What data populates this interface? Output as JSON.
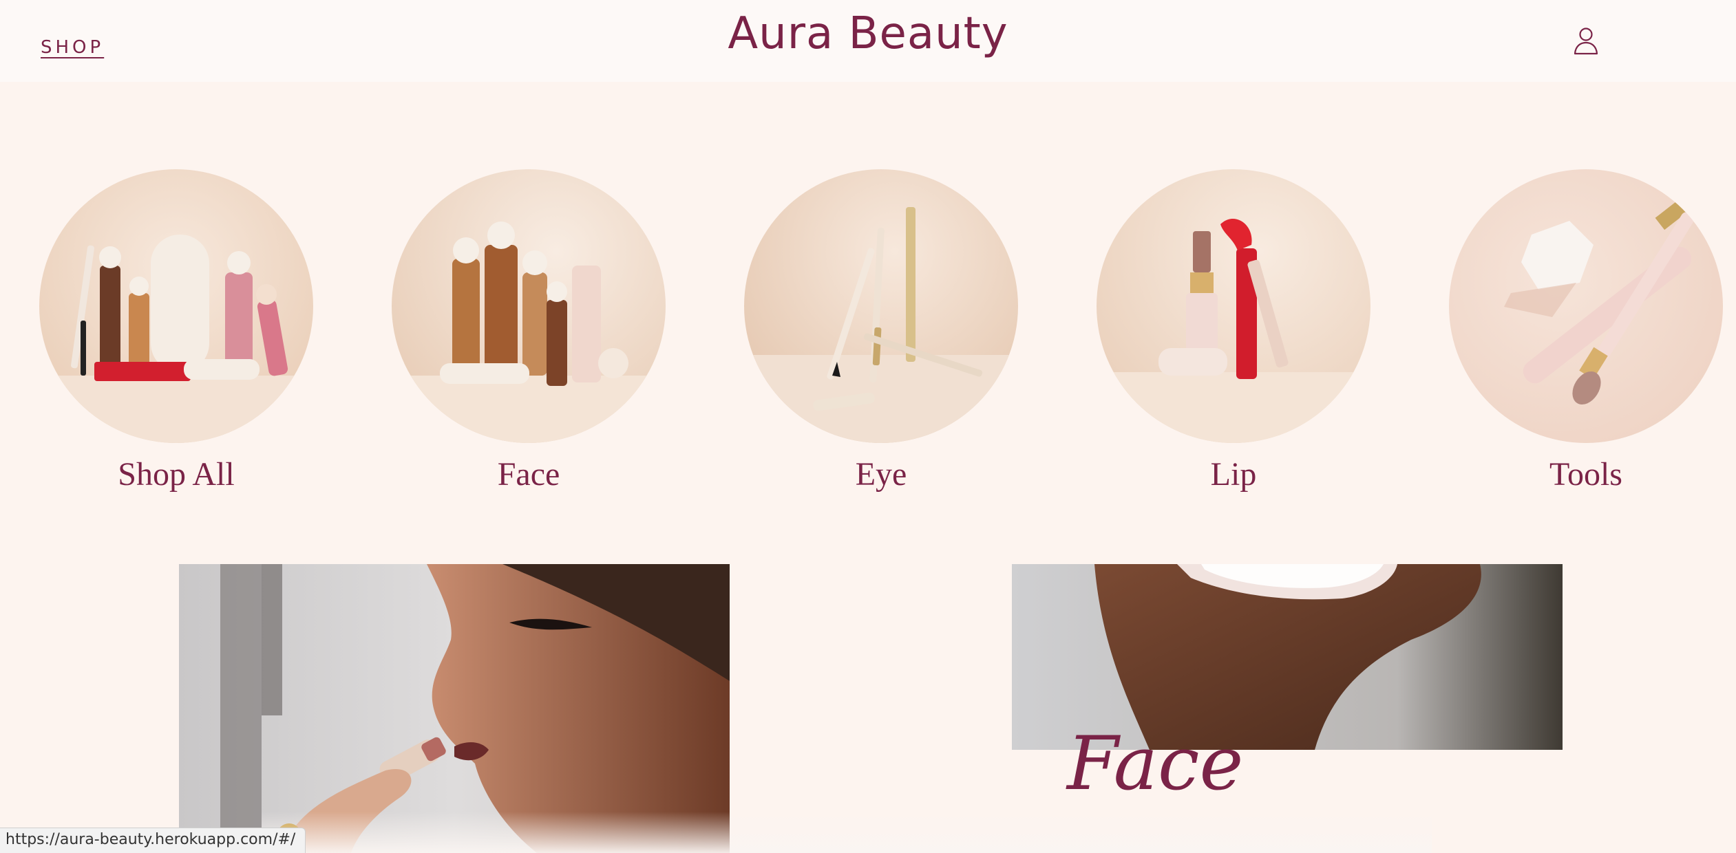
{
  "header": {
    "shop_label": "SHOP",
    "brand": "Aura Beauty",
    "account_icon": "user-icon"
  },
  "categories": [
    {
      "label": "Shop All"
    },
    {
      "label": "Face"
    },
    {
      "label": "Eye"
    },
    {
      "label": "Lip"
    },
    {
      "label": "Tools"
    }
  ],
  "promos": {
    "right_title": "Face"
  },
  "status_bar": {
    "url": "https://aura-beauty.herokuapp.com/#/"
  },
  "colors": {
    "brand": "#7a2347",
    "background": "#fdf4ef",
    "header_bg": "#fdf9f7"
  }
}
